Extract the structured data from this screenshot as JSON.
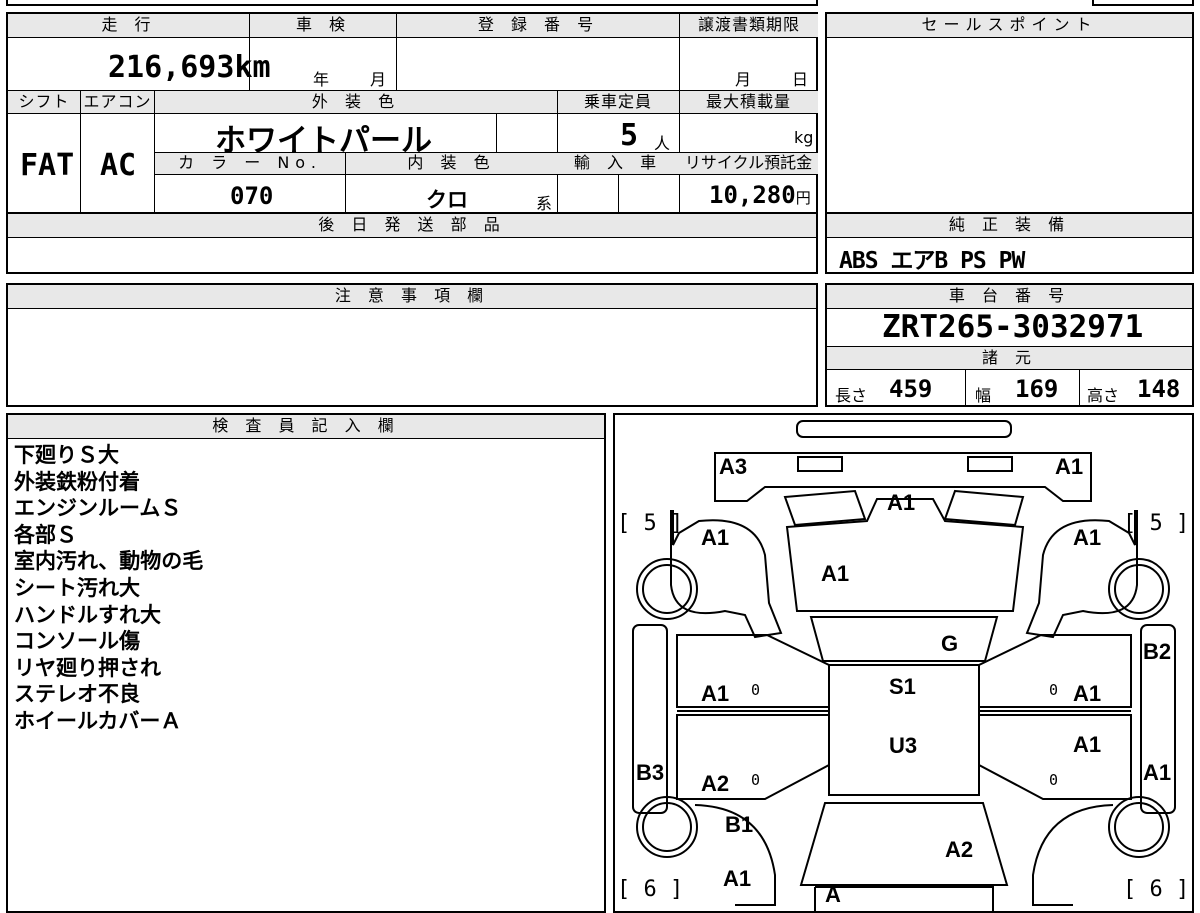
{
  "mileage": {
    "header": "走 行",
    "value": "216,693",
    "unit": "km"
  },
  "inspection": {
    "header": "車 検",
    "year_label": "年",
    "month_label": "月"
  },
  "registration": {
    "header": "登 録 番 号"
  },
  "transfer": {
    "header": "譲渡書類期限",
    "month_label": "月",
    "day_label": "日"
  },
  "sales_point": {
    "header": "セールスポイント"
  },
  "shift": {
    "header": "シフト",
    "value": "FAT"
  },
  "aircon": {
    "header": "エアコン",
    "value": "AC"
  },
  "exterior_color": {
    "header": "外 装 色",
    "value": "ホワイトパール"
  },
  "capacity": {
    "header": "乗車定員",
    "value": "5",
    "unit": "人"
  },
  "max_load": {
    "header": "最大積載量",
    "unit": "kg"
  },
  "color_no": {
    "header": "カ ラ ー No.",
    "value": "070"
  },
  "interior_color": {
    "header": "内 装 色",
    "value": "クロ",
    "suffix": "系"
  },
  "import": {
    "header": "輸 入 車"
  },
  "recycle": {
    "header": "リサイクル預託金",
    "value": "10,280",
    "unit": "円"
  },
  "later_parts": {
    "header": "後 日 発 送 部 品"
  },
  "standard_equipment": {
    "header": "純 正 装 備",
    "value": "ABS エアB PS PW"
  },
  "caution": {
    "header": "注 意 事 項 欄"
  },
  "chassis": {
    "header": "車 台 番 号",
    "value": "ZRT265-3032971"
  },
  "specs": {
    "header": "諸 元",
    "length_label": "長さ",
    "length": "459",
    "width_label": "幅",
    "width": "169",
    "height_label": "高さ",
    "height": "148"
  },
  "inspector": {
    "header": "検 査 員 記 入 欄",
    "notes": [
      "下廻りＳ大",
      "外装鉄粉付着",
      "エンジンルームＳ",
      "各部Ｓ",
      "室内汚れ、動物の毛",
      "シート汚れ大",
      "ハンドルすれ大",
      "コンソール傷",
      "リヤ廻り押され",
      "ステレオ不良",
      "ホイールカバーＡ"
    ]
  },
  "diagram": {
    "labels": {
      "front_left": "A3",
      "front_right": "A1",
      "hood": "A1",
      "fender_left": "A1",
      "fender_right": "A1",
      "windshield": "A1",
      "glass": "G",
      "roof": "S1",
      "roof_rear": "U3",
      "rear_glass": "A2",
      "side_right_b": "B2",
      "door_fl": "A1",
      "door_fr": "A1",
      "door_rl": "A2",
      "door_rr": "A1",
      "qtr_left": "B3",
      "qtr_right": "A1",
      "rear_fender_left": "B1",
      "rear_left": "A1",
      "rear_bumper": "A"
    },
    "brackets": {
      "front_left": "[ 5 ]",
      "front_right": "[ 5 ]",
      "rear_left": "[ 6 ]",
      "rear_right": "[ 6 ]"
    },
    "marks": {
      "door_fl": "0",
      "door_fr": "0",
      "door_rl": "0",
      "door_rr": "0"
    }
  }
}
